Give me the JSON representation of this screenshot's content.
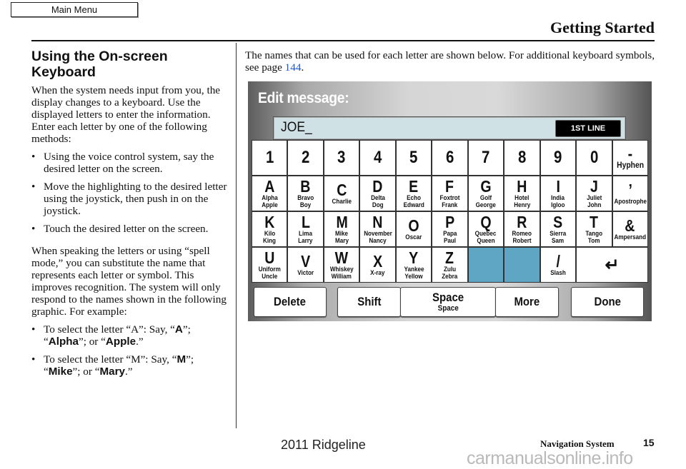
{
  "nav": {
    "main_menu_label": "Main Menu"
  },
  "header": {
    "title": "Getting Started"
  },
  "left": {
    "heading": "Using the On-screen Keyboard",
    "para1": "When the system needs input from you, the display changes to a keyboard. Use the displayed letters to enter the information. Enter each letter by one of the following methods:",
    "methods": [
      "Using the voice control system, say the desired letter on the screen.",
      "Move the highlighting to the desired letter using the joystick, then push in on the joystick.",
      "Touch the desired letter on the screen."
    ],
    "para2": "When speaking the letters or using “spell mode,” you can substitute the name that represents each letter or symbol. This improves recognition. The system will only respond to the names shown in the following graphic. For example:",
    "example_a": {
      "prefix": "To select the letter “A”: Say, “",
      "letter": "A",
      "mid1": "”; “",
      "name1": "Alpha",
      "mid2": "”; or “",
      "name2": "Apple",
      "suffix": ".”"
    },
    "example_m": {
      "prefix": "To select the letter “M”: Say, “",
      "letter": "M",
      "mid1": "”; “",
      "name1": "Mike",
      "mid2": "”; or “",
      "name2": "Mary",
      "suffix": ".”"
    }
  },
  "intro": {
    "text": "The names that can be used for each letter are shown below. For additional keyboard symbols, see page ",
    "page_link": "144",
    "suffix": "."
  },
  "keyboard": {
    "title": "Edit message:",
    "input_value": "JOE_",
    "line_button": "1ST LINE",
    "colors": {
      "blank_key": "#5fa5c4",
      "input_bg": "#d0e1e6"
    },
    "rows": [
      [
        {
          "key": "1"
        },
        {
          "key": "2"
        },
        {
          "key": "3"
        },
        {
          "key": "4"
        },
        {
          "key": "5"
        },
        {
          "key": "6"
        },
        {
          "key": "7"
        },
        {
          "key": "8"
        },
        {
          "key": "9"
        },
        {
          "key": "0"
        },
        {
          "key": "-",
          "names": [
            "Hyphen"
          ]
        }
      ],
      [
        {
          "key": "A",
          "names": [
            "Alpha",
            "Apple"
          ]
        },
        {
          "key": "B",
          "names": [
            "Bravo",
            "Boy"
          ]
        },
        {
          "key": "C",
          "names": [
            "Charlie"
          ]
        },
        {
          "key": "D",
          "names": [
            "Delta",
            "Dog"
          ]
        },
        {
          "key": "E",
          "names": [
            "Echo",
            "Edward"
          ]
        },
        {
          "key": "F",
          "names": [
            "Foxtrot",
            "Frank"
          ]
        },
        {
          "key": "G",
          "names": [
            "Golf",
            "George"
          ]
        },
        {
          "key": "H",
          "names": [
            "Hotel",
            "Henry"
          ]
        },
        {
          "key": "I",
          "names": [
            "India",
            "Igloo"
          ]
        },
        {
          "key": "J",
          "names": [
            "Juliet",
            "John"
          ]
        },
        {
          "key": "’",
          "names": [
            "Apostrophe"
          ]
        }
      ],
      [
        {
          "key": "K",
          "names": [
            "Kilo",
            "King"
          ]
        },
        {
          "key": "L",
          "names": [
            "Lima",
            "Larry"
          ]
        },
        {
          "key": "M",
          "names": [
            "Mike",
            "Mary"
          ]
        },
        {
          "key": "N",
          "names": [
            "November",
            "Nancy"
          ]
        },
        {
          "key": "O",
          "names": [
            "Oscar"
          ]
        },
        {
          "key": "P",
          "names": [
            "Papa",
            "Paul"
          ]
        },
        {
          "key": "Q",
          "names": [
            "Quebec",
            "Queen"
          ]
        },
        {
          "key": "R",
          "names": [
            "Romeo",
            "Robert"
          ]
        },
        {
          "key": "S",
          "names": [
            "Sierra",
            "Sam"
          ]
        },
        {
          "key": "T",
          "names": [
            "Tango",
            "Tom"
          ]
        },
        {
          "key": "&",
          "names": [
            "Ampersand"
          ]
        }
      ],
      [
        {
          "key": "U",
          "names": [
            "Uniform",
            "Uncle"
          ]
        },
        {
          "key": "V",
          "names": [
            "Victor"
          ]
        },
        {
          "key": "W",
          "names": [
            "Whiskey",
            "William"
          ]
        },
        {
          "key": "X",
          "names": [
            "X-ray"
          ]
        },
        {
          "key": "Y",
          "names": [
            "Yankee",
            "Yellow"
          ]
        },
        {
          "key": "Z",
          "names": [
            "Zulu",
            "Zebra"
          ]
        },
        {
          "key": "",
          "blank": true
        },
        {
          "key": "",
          "blank": true
        },
        {
          "key": "/",
          "names": [
            "Slash"
          ]
        },
        {
          "key": "↵",
          "enter": true,
          "icon": "enter-arrow-icon"
        }
      ]
    ],
    "bottom_buttons": [
      {
        "id": "delete",
        "label": "Delete"
      },
      {
        "id": "shift",
        "label": "Shift"
      },
      {
        "id": "space",
        "label": "Space",
        "sub": "Space"
      },
      {
        "id": "more",
        "label": "More"
      },
      {
        "id": "done",
        "label": "Done"
      }
    ]
  },
  "footer": {
    "model": "2011 Ridgeline",
    "section": "Navigation System",
    "page": "15",
    "watermark": "carmanualsonline.info"
  }
}
